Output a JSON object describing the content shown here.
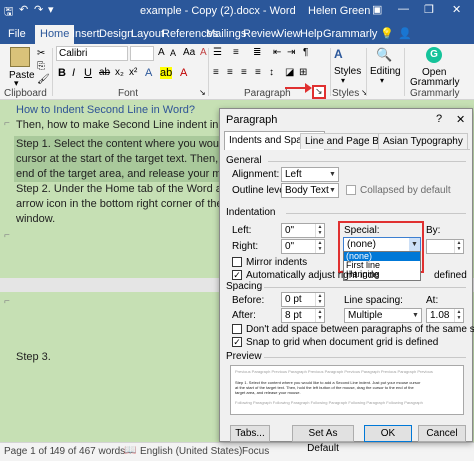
{
  "titlebar": {
    "doc_title": "example - Copy (2).docx - Word",
    "user": "Helen Green",
    "minimize": "—",
    "restore": "❐",
    "close": "✕"
  },
  "tabs": [
    "File",
    "Home",
    "Insert",
    "Design",
    "Layout",
    "References",
    "Mailings",
    "Review",
    "View",
    "Help",
    "Grammarly"
  ],
  "active_tab": "Home",
  "ribbon": {
    "paste_label": "Paste",
    "clipboard_group": "Clipboard",
    "font_name": "Calibri",
    "font_group": "Font",
    "paragraph_group": "Paragraph",
    "styles_label": "Styles",
    "styles_group": "Styles",
    "editing_label": "Editing",
    "grammarly_label_1": "Open",
    "grammarly_label_2": "Grammarly",
    "grammarly_group": "Grammarly"
  },
  "document": {
    "heading": "How to Indent Second Line in Word?",
    "line2": "Then, how to make Second Line indent in Word? Just",
    "step1_a": "Step 1. Select the content where you would like to ad",
    "step1_b": "cursor at the start of the target text. Then, hold the le",
    "step1_c": "end of the target area, and release your mouse.",
    "step2_a": "Step 2. Under the Home tab of the Word application,",
    "step2_b": "arrow icon in the bottom right corner of the Paragrap",
    "step2_c": "window.",
    "step3": "Step 3."
  },
  "status": {
    "page": "Page 1 of 1",
    "words": "49 of 467 words",
    "language": "English (United States)",
    "focus": "Focus"
  },
  "dialog": {
    "title": "Paragraph",
    "help": "?",
    "close": "✕",
    "tabs": [
      "Indents and Spacing",
      "Line and Page Breaks",
      "Asian Typography"
    ],
    "general": "General",
    "alignment_label": "Alignment:",
    "alignment_value": "Left",
    "outline_label": "Outline level:",
    "outline_value": "Body Text",
    "collapsed_label": "Collapsed by default",
    "indentation": "Indentation",
    "left_label": "Left:",
    "left_value": "0\"",
    "right_label": "Right:",
    "right_value": "0\"",
    "special_label": "Special:",
    "special_value": "(none)",
    "special_options": [
      "(none)",
      "First line",
      "Hanging"
    ],
    "by_label": "By:",
    "mirror_label": "Mirror indents",
    "auto_adjust_label": "Automatically adjust right inde",
    "defined_label": "defined",
    "spacing": "Spacing",
    "before_label": "Before:",
    "before_value": "0 pt",
    "after_label": "After:",
    "after_value": "8 pt",
    "line_spacing_label": "Line spacing:",
    "line_spacing_value": "Multiple",
    "at_label": "At:",
    "at_value": "1.08",
    "dont_add_label": "Don't add space between paragraphs of the same style",
    "snap_label": "Snap to grid when document grid is defined",
    "preview": "Preview",
    "preview_text_1": "Previous Paragraph Previous Paragraph Previous Paragraph Previous Paragraph Previous Paragraph Previous",
    "preview_text_2": "Step 1. Select the content where you would like to add a Second Line indent. Just put your mouse cursor",
    "preview_text_3": "at the start of the target text. Then, hold the left button of the mouse, drag the cursor to the end of the",
    "preview_text_4": "target area, and release your mouse.",
    "preview_text_5": "Following Paragraph Following Paragraph Following Paragraph Following Paragraph Following Paragraph",
    "tabs_button": "Tabs...",
    "default_button": "Set As Default",
    "ok_button": "OK",
    "cancel_button": "Cancel"
  }
}
